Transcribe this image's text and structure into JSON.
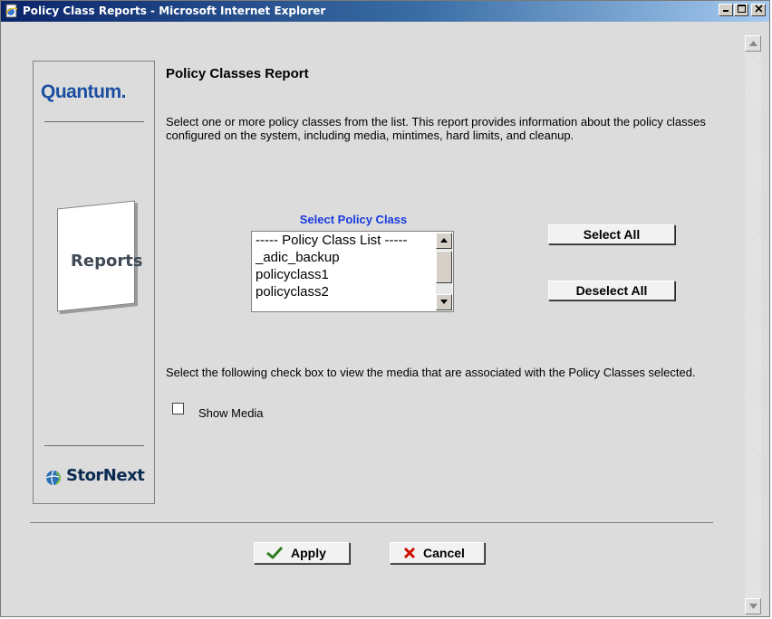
{
  "window": {
    "title": "Policy Class Reports - Microsoft Internet Explorer",
    "controls": [
      "minimize",
      "maximize",
      "close"
    ]
  },
  "sidebar": {
    "brand": "Quantum.",
    "section_label": "Reports",
    "product": "StorNext"
  },
  "main": {
    "title": "Policy Classes Report",
    "description": "Select one or more policy classes from the list. This report provides information about the policy classes configured on the system, including media, mintimes, hard limits, and cleanup.",
    "select_label": "Select Policy Class",
    "list_items": [
      "----- Policy Class List -----",
      "_adic_backup",
      "policyclass1",
      "policyclass2"
    ],
    "select_all_label": "Select All",
    "deselect_all_label": "Deselect All",
    "checkbox_description": "Select the following check box to view the media that are associated with the Policy Classes selected.",
    "checkbox_label": "Show Media",
    "checkbox_checked": false
  },
  "footer": {
    "apply_label": "Apply",
    "cancel_label": "Cancel"
  },
  "colors": {
    "title_bar": "#0a246a",
    "select_label": "#1a3ae0",
    "brand": "#1b4ea1",
    "apply_icon": "#2e7d1e",
    "cancel_icon": "#cc1100"
  }
}
